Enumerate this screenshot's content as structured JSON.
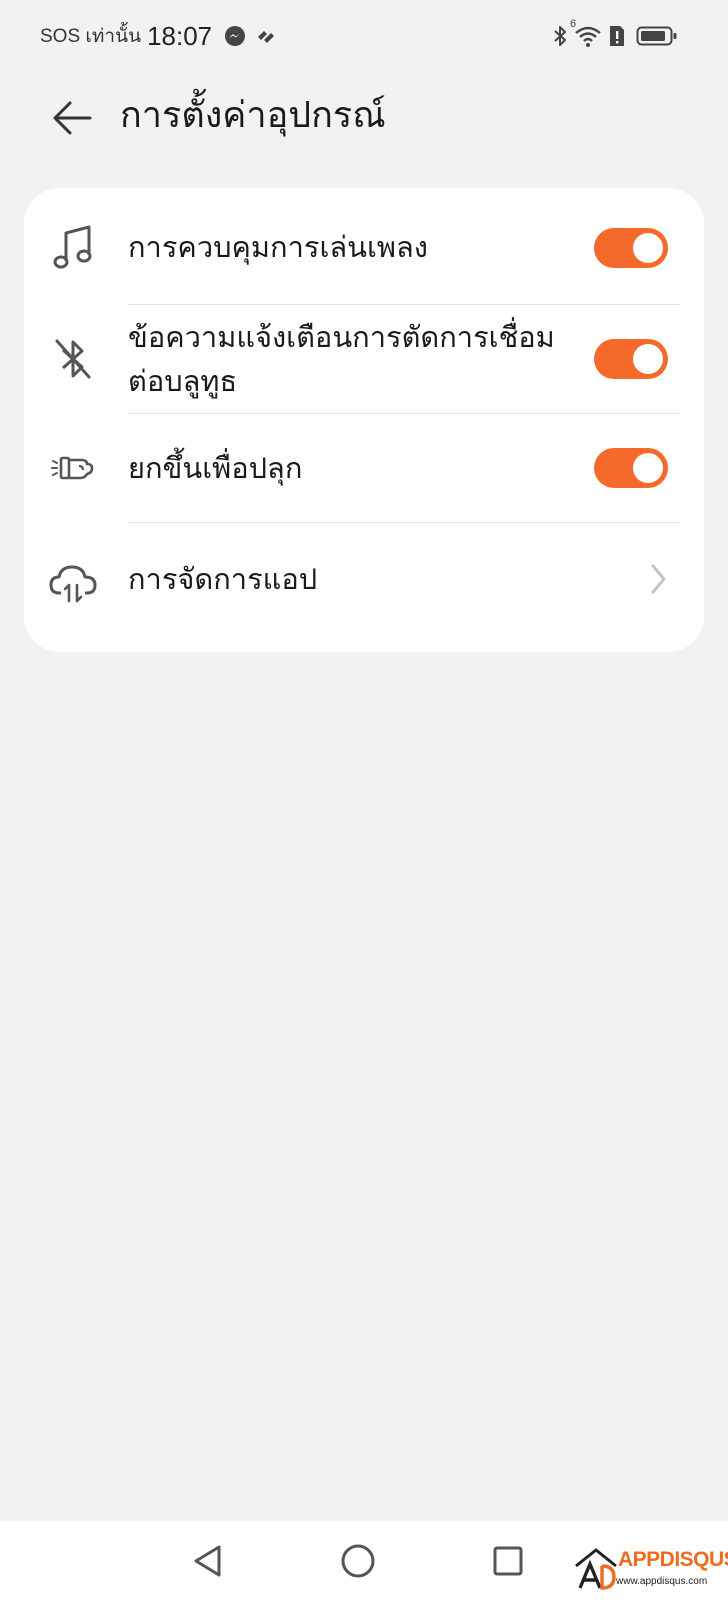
{
  "status_bar": {
    "sos_text": "SOS เท่านั้น",
    "time": "18:07",
    "network_label": "6",
    "left_icons": [
      "messenger-icon",
      "app-notification-icon"
    ],
    "right_icons": [
      "bluetooth-icon",
      "wifi-icon",
      "alert-icon",
      "battery-icon"
    ]
  },
  "header": {
    "title": "การตั้งค่าอุปกรณ์",
    "back_icon": "arrow-left-icon"
  },
  "settings": {
    "items": [
      {
        "label": "การควบคุมการเล่นเพลง",
        "icon": "music-note-icon",
        "toggle_on": true
      },
      {
        "label": "ข้อความแจ้งเตือนการตัดการเชื่อมต่อบลูทูธ",
        "icon": "bluetooth-off-icon",
        "toggle_on": true
      },
      {
        "label": "ยกขึ้นเพื่อปลุก",
        "icon": "raise-wrist-icon",
        "toggle_on": true
      },
      {
        "label": "การจัดการแอป",
        "icon": "cloud-sync-icon",
        "chevron": "chevron-right-icon"
      }
    ]
  },
  "nav_bar": {
    "buttons": [
      "back-triangle-icon",
      "home-circle-icon",
      "recents-square-icon"
    ]
  },
  "watermark": {
    "brand": "APPDISQUS",
    "url": "www.appdisqus.com"
  },
  "colors": {
    "accent": "#f56a2b",
    "background": "#f1f2f4",
    "card": "#ffffff",
    "text": "#1a1a1a",
    "icon": "#555555"
  }
}
